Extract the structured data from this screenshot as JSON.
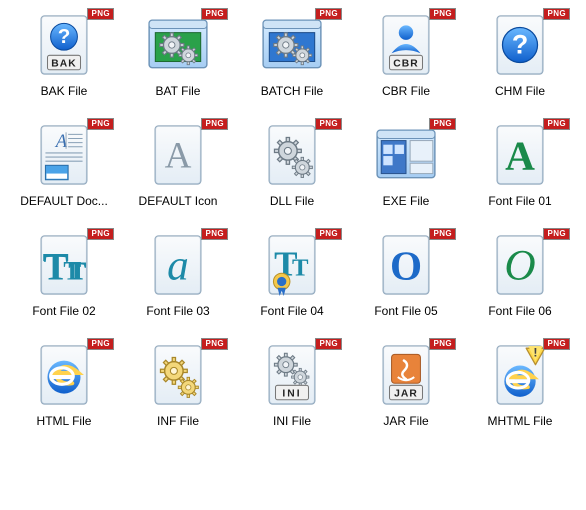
{
  "badge_text": "PNG",
  "items": [
    {
      "id": "bak",
      "label": "BAK File",
      "icon": "bak-icon"
    },
    {
      "id": "bat",
      "label": "BAT File",
      "icon": "bat-icon"
    },
    {
      "id": "batch",
      "label": "BATCH File",
      "icon": "batch-icon"
    },
    {
      "id": "cbr",
      "label": "CBR File",
      "icon": "cbr-icon"
    },
    {
      "id": "chm",
      "label": "CHM File",
      "icon": "chm-icon"
    },
    {
      "id": "default-doc",
      "label": "DEFAULT Doc...",
      "icon": "default-doc-icon"
    },
    {
      "id": "default-icon",
      "label": "DEFAULT Icon",
      "icon": "default-icon-icon"
    },
    {
      "id": "dll",
      "label": "DLL File",
      "icon": "dll-icon"
    },
    {
      "id": "exe",
      "label": "EXE File",
      "icon": "exe-icon"
    },
    {
      "id": "font01",
      "label": "Font File 01",
      "icon": "font01-icon"
    },
    {
      "id": "font02",
      "label": "Font File 02",
      "icon": "font02-icon"
    },
    {
      "id": "font03",
      "label": "Font File 03",
      "icon": "font03-icon"
    },
    {
      "id": "font04",
      "label": "Font File 04",
      "icon": "font04-icon"
    },
    {
      "id": "font05",
      "label": "Font File 05",
      "icon": "font05-icon"
    },
    {
      "id": "font06",
      "label": "Font File 06",
      "icon": "font06-icon"
    },
    {
      "id": "html",
      "label": "HTML File",
      "icon": "html-icon"
    },
    {
      "id": "inf",
      "label": "INF File",
      "icon": "inf-icon"
    },
    {
      "id": "ini",
      "label": "INI File",
      "icon": "ini-icon"
    },
    {
      "id": "jar",
      "label": "JAR File",
      "icon": "jar-icon"
    },
    {
      "id": "mhtml",
      "label": "MHTML File",
      "icon": "mhtml-icon"
    }
  ]
}
